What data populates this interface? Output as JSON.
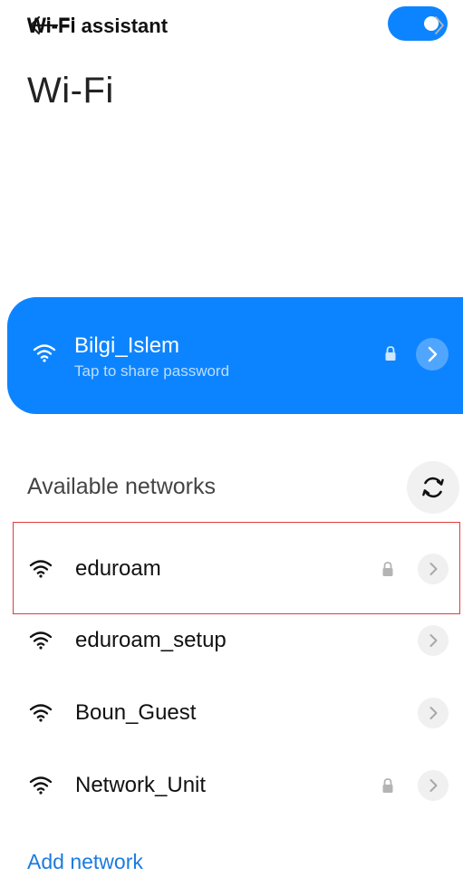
{
  "header": {
    "back_icon": "back-arrow-icon",
    "scan_icon": "qr-scan-icon",
    "title": "Wi-Fi"
  },
  "wifi_toggle": {
    "label": "Wi-Fi",
    "state": "on",
    "accent_color": "#0d84ff"
  },
  "assistant": {
    "label": "Wi-Fi assistant",
    "chevron_icon": "chevron-right-icon"
  },
  "connected_network": {
    "name": "Bilgi_Islem",
    "subtitle": "Tap to share password",
    "secured": true,
    "background_color": "#0d84ff"
  },
  "available": {
    "header": "Available networks",
    "refresh_icon": "refresh-icon",
    "networks": [
      {
        "name": "eduroam",
        "secured": true,
        "highlighted": true
      },
      {
        "name": "eduroam_setup",
        "secured": false
      },
      {
        "name": "Boun_Guest",
        "secured": false
      },
      {
        "name": "Network_Unit",
        "secured": true
      }
    ]
  },
  "add_network": {
    "label": "Add network",
    "color": "#1b7be0"
  },
  "highlight_color": "#de3c3c"
}
